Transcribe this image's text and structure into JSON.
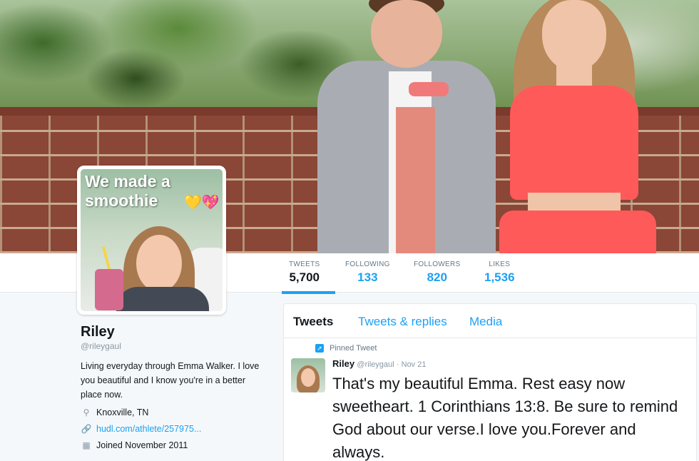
{
  "avatar": {
    "caption": "We made a smoothie",
    "caption_emoji": "💛💖"
  },
  "stats": [
    {
      "label": "TWEETS",
      "value": "5,700"
    },
    {
      "label": "FOLLOWING",
      "value": "133"
    },
    {
      "label": "FOLLOWERS",
      "value": "820"
    },
    {
      "label": "LIKES",
      "value": "1,536"
    }
  ],
  "profile": {
    "name": "Riley",
    "handle": "@rileygaul",
    "bio": "Living everyday through Emma Walker. I love you beautiful and I know you're in a better place now.",
    "location": "Knoxville, TN",
    "website": "hudl.com/athlete/257975...",
    "joined": "Joined November 2011"
  },
  "timeline": {
    "tabs": [
      "Tweets",
      "Tweets & replies",
      "Media"
    ],
    "pinned_label": "Pinned Tweet",
    "tweet": {
      "name": "Riley",
      "handle": "@rileygaul",
      "date": "· Nov 21",
      "text": "That's my beautiful Emma. Rest easy now sweetheart. 1 Corinthians 13:8. Be sure to remind God about our verse.I love you.Forever and always."
    }
  },
  "colors": {
    "accent": "#1da1f2",
    "text": "#14171a",
    "muted": "#657786"
  },
  "icons": {
    "location": "location-pin-icon",
    "link": "link-icon",
    "calendar": "calendar-icon",
    "pinned": "pin-icon"
  }
}
